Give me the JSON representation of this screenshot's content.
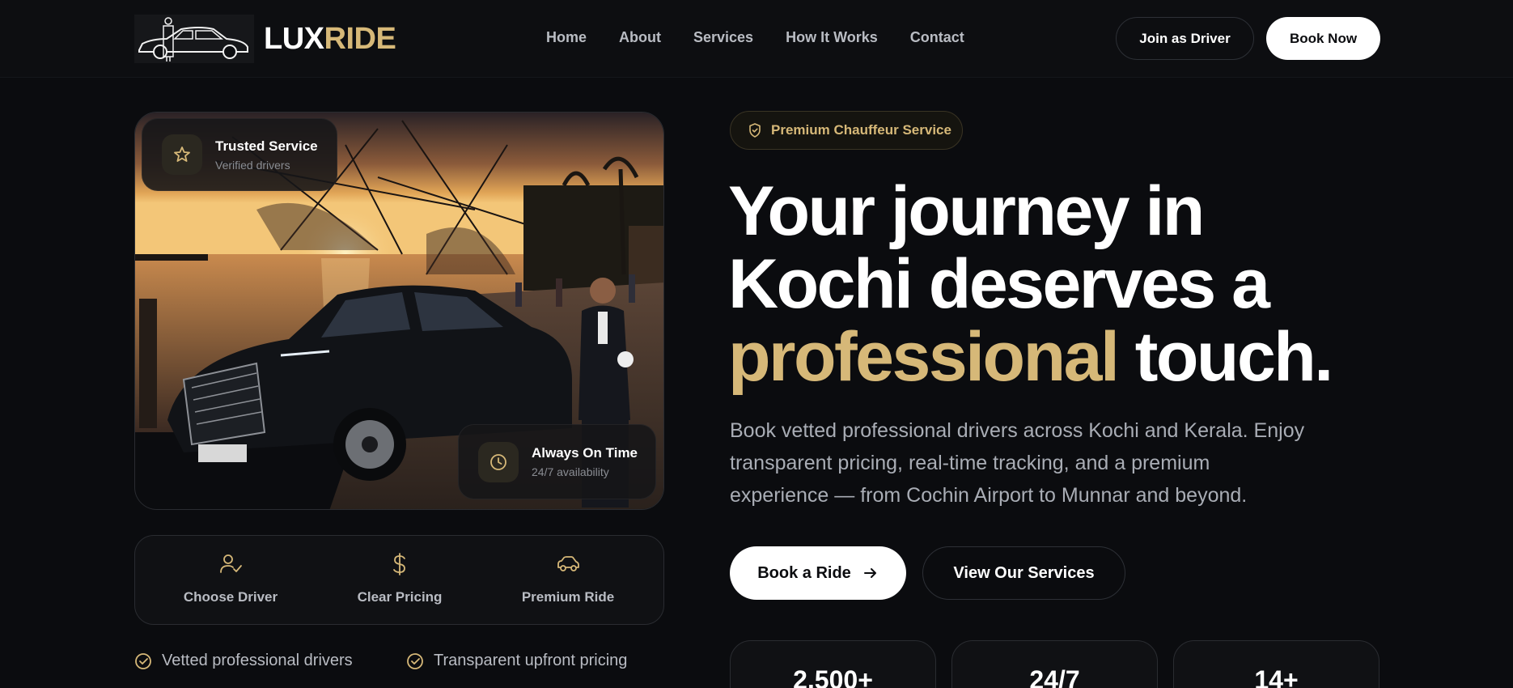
{
  "brand": {
    "name_part1": "LUX",
    "name_part2": "RIDE"
  },
  "nav": {
    "items": [
      "Home",
      "About",
      "Services",
      "How It Works",
      "Contact"
    ]
  },
  "header": {
    "join_label": "Join as Driver",
    "book_label": "Book Now"
  },
  "hero_image": {
    "badge_top": {
      "title": "Trusted Service",
      "subtitle": "Verified drivers",
      "icon": "star-icon"
    },
    "badge_bottom": {
      "title": "Always On Time",
      "subtitle": "24/7 availability",
      "icon": "clock-icon"
    }
  },
  "features": [
    {
      "label": "Choose Driver",
      "icon": "user-check-icon"
    },
    {
      "label": "Clear Pricing",
      "icon": "dollar-icon"
    },
    {
      "label": "Premium Ride",
      "icon": "car-icon"
    }
  ],
  "checks": [
    "Vetted professional drivers",
    "Transparent upfront pricing"
  ],
  "hero": {
    "pill": "Premium Chauffeur Service",
    "headline_line1": "Your journey in",
    "headline_line2": "Kochi deserves a",
    "headline_gold": "professional",
    "headline_end": " touch.",
    "subtitle": "Book vetted professional drivers across Kochi and Kerala. Enjoy transparent pricing, real-time tracking, and a premium experience — from Cochin Airport to Munnar and beyond.",
    "cta_primary": "Book a Ride",
    "cta_secondary": "View Our Services"
  },
  "stats": [
    {
      "value": "2,500+"
    },
    {
      "value": "24/7"
    },
    {
      "value": "14+"
    }
  ],
  "colors": {
    "accent_gold": "#d6b878",
    "background": "#0b0c0f",
    "text_muted": "#b9bcc3"
  }
}
